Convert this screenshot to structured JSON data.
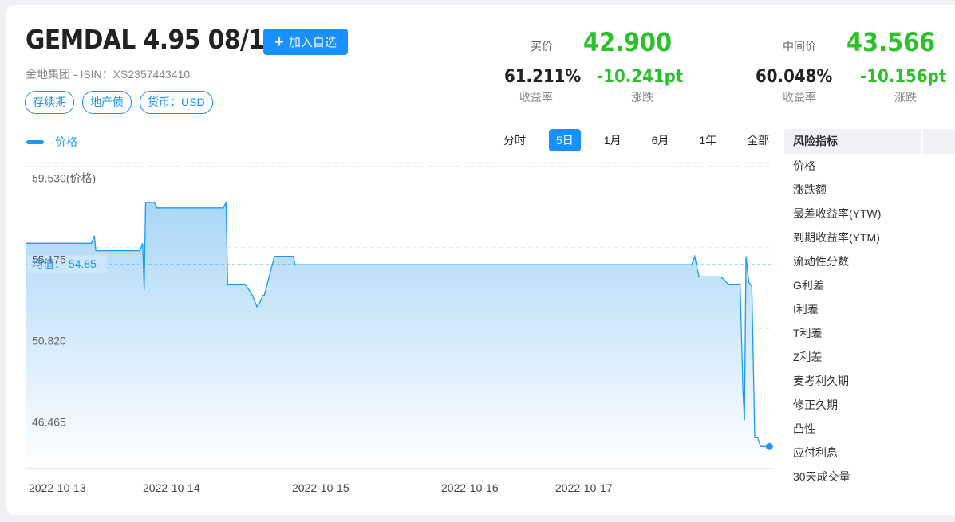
{
  "header": {
    "title": "GEMDAL 4.95 08/12/24",
    "add_button": "加入自选",
    "subtitle": "金地集团 - ISIN：XS2357443410",
    "tags": [
      "存续期",
      "地产债",
      "货币：USD"
    ]
  },
  "bid": {
    "label": "买价",
    "price": "42.900",
    "yield": "61.211%",
    "yield_label": "收益率",
    "change": "-10.241pt",
    "change_label": "涨跌"
  },
  "mid": {
    "label": "中间价",
    "price": "43.566",
    "yield": "60.048%",
    "yield_label": "收益率",
    "change": "-10.156pt",
    "change_label": "涨跌"
  },
  "legend": {
    "price": "价格"
  },
  "range_tabs": [
    "分时",
    "5日",
    "1月",
    "6月",
    "1年",
    "全部"
  ],
  "active_range": "5日",
  "risk_panel": {
    "header": "风险指标",
    "items": [
      "价格",
      "涨跌额",
      "最差收益率(YTW)",
      "到期收益率(YTM)",
      "流动性分数",
      "G利差",
      "I利差",
      "T利差",
      "Z利差",
      "麦考利久期",
      "修正久期",
      "凸性",
      "应付利息",
      "30天成交量"
    ]
  },
  "colors": {
    "accent": "#1890ff",
    "up_green": "#2bc12b",
    "line": "#1a9af0"
  },
  "chart_data": {
    "type": "area",
    "series": [
      {
        "name": "价格",
        "values": [
          [
            0,
            56.0
          ],
          [
            0.45,
            56.0
          ],
          [
            0.47,
            56.4
          ],
          [
            0.48,
            55.6
          ],
          [
            0.78,
            55.6
          ],
          [
            0.8,
            56.0
          ],
          [
            0.81,
            53.5
          ],
          [
            0.82,
            58.2
          ],
          [
            0.85,
            58.2
          ],
          [
            0.88,
            58.2
          ],
          [
            0.9,
            57.9
          ],
          [
            1.0,
            57.9
          ],
          [
            1.35,
            57.9
          ],
          [
            1.37,
            58.2
          ],
          [
            1.38,
            53.8
          ],
          [
            1.5,
            53.8
          ],
          [
            1.55,
            53.2
          ],
          [
            1.58,
            52.6
          ],
          [
            1.6,
            52.8
          ],
          [
            1.62,
            53.2
          ],
          [
            1.63,
            53.2
          ],
          [
            1.7,
            55.3
          ],
          [
            1.75,
            55.3
          ],
          [
            1.83,
            55.3
          ],
          [
            1.84,
            54.85
          ],
          [
            2.0,
            54.85
          ],
          [
            3.0,
            54.85
          ],
          [
            4.0,
            54.85
          ],
          [
            4.5,
            54.85
          ],
          [
            4.55,
            54.85
          ],
          [
            4.57,
            55.3
          ],
          [
            4.6,
            54.2
          ],
          [
            4.75,
            54.2
          ],
          [
            4.8,
            53.8
          ],
          [
            4.88,
            53.8
          ],
          [
            4.9,
            48.0
          ],
          [
            4.91,
            46.5
          ],
          [
            4.92,
            55.3
          ],
          [
            4.94,
            53.9
          ],
          [
            4.96,
            53.7
          ],
          [
            4.98,
            45.6
          ],
          [
            5.0,
            45.6
          ],
          [
            5.02,
            45.1
          ],
          [
            5.08,
            45.1
          ]
        ]
      }
    ],
    "x_tick_labels": [
      "2022-10-13",
      "2022-10-14",
      "2022-10-15",
      "2022-10-16",
      "2022-10-17"
    ],
    "y_tick_labels": [
      "59.530(价格)",
      "55.175",
      "50.820",
      "46.465"
    ],
    "y_ticks": [
      59.53,
      55.175,
      50.82,
      46.465
    ],
    "ylim": [
      44.0,
      60.5
    ],
    "mean_label": "均值： 54.85",
    "mean_value": 54.85,
    "grid": true
  }
}
